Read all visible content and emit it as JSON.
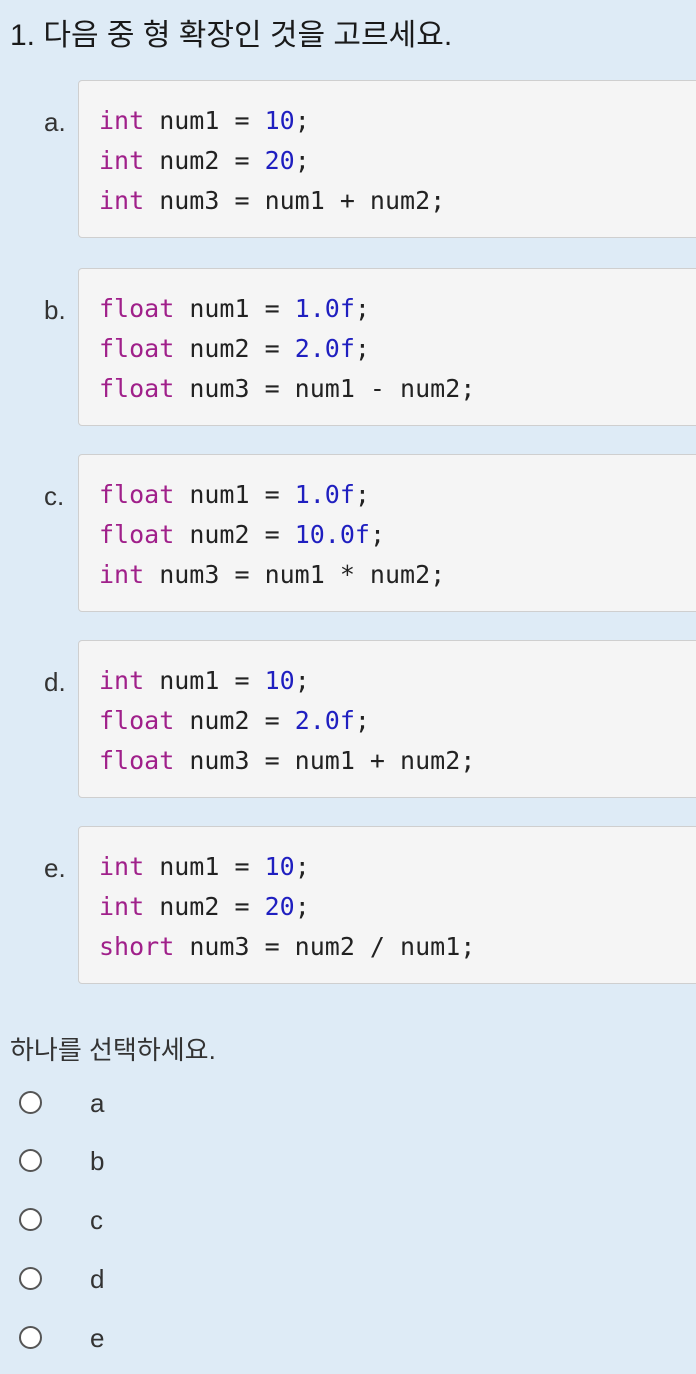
{
  "question": {
    "title": "1. 다음 중 형 확장인 것을 고르세요."
  },
  "options": [
    {
      "letter": "a.",
      "lines": [
        [
          {
            "t": "int",
            "c": "kw"
          },
          {
            "t": " num1 = ",
            "c": ""
          },
          {
            "t": "10",
            "c": "num"
          },
          {
            "t": ";",
            "c": ""
          }
        ],
        [
          {
            "t": "int",
            "c": "kw"
          },
          {
            "t": " num2 = ",
            "c": ""
          },
          {
            "t": "20",
            "c": "num"
          },
          {
            "t": ";",
            "c": ""
          }
        ],
        [
          {
            "t": "int",
            "c": "kw"
          },
          {
            "t": " num3 = num1 + num2;",
            "c": ""
          }
        ]
      ]
    },
    {
      "letter": "b.",
      "lines": [
        [
          {
            "t": "float",
            "c": "kw"
          },
          {
            "t": " num1 = ",
            "c": ""
          },
          {
            "t": "1.0f",
            "c": "num"
          },
          {
            "t": ";",
            "c": ""
          }
        ],
        [
          {
            "t": "float",
            "c": "kw"
          },
          {
            "t": " num2 = ",
            "c": ""
          },
          {
            "t": "2.0f",
            "c": "num"
          },
          {
            "t": ";",
            "c": ""
          }
        ],
        [
          {
            "t": "float",
            "c": "kw"
          },
          {
            "t": " num3 = num1 - num2;",
            "c": ""
          }
        ]
      ]
    },
    {
      "letter": "c.",
      "lines": [
        [
          {
            "t": "float",
            "c": "kw"
          },
          {
            "t": " num1 = ",
            "c": ""
          },
          {
            "t": "1.0f",
            "c": "num"
          },
          {
            "t": ";",
            "c": ""
          }
        ],
        [
          {
            "t": "float",
            "c": "kw"
          },
          {
            "t": " num2 = ",
            "c": ""
          },
          {
            "t": "10.0f",
            "c": "num"
          },
          {
            "t": ";",
            "c": ""
          }
        ],
        [
          {
            "t": "int",
            "c": "kw"
          },
          {
            "t": " num3 = num1 * num2;",
            "c": ""
          }
        ]
      ]
    },
    {
      "letter": "d.",
      "lines": [
        [
          {
            "t": "int",
            "c": "kw"
          },
          {
            "t": " num1 = ",
            "c": ""
          },
          {
            "t": "10",
            "c": "num"
          },
          {
            "t": ";",
            "c": ""
          }
        ],
        [
          {
            "t": "float",
            "c": "kw"
          },
          {
            "t": " num2 = ",
            "c": ""
          },
          {
            "t": "2.0f",
            "c": "num"
          },
          {
            "t": ";",
            "c": ""
          }
        ],
        [
          {
            "t": "float",
            "c": "kw"
          },
          {
            "t": " num3 = num1 + num2;",
            "c": ""
          }
        ]
      ]
    },
    {
      "letter": "e.",
      "lines": [
        [
          {
            "t": "int",
            "c": "kw"
          },
          {
            "t": " num1 = ",
            "c": ""
          },
          {
            "t": "10",
            "c": "num"
          },
          {
            "t": ";",
            "c": ""
          }
        ],
        [
          {
            "t": "int",
            "c": "kw"
          },
          {
            "t": " num2 = ",
            "c": ""
          },
          {
            "t": "20",
            "c": "num"
          },
          {
            "t": ";",
            "c": ""
          }
        ],
        [
          {
            "t": "short",
            "c": "kw"
          },
          {
            "t": " num3 = num2 / num1;",
            "c": ""
          }
        ]
      ]
    }
  ],
  "prompt": "하나를 선택하세요.",
  "choices": [
    {
      "label": "a",
      "selected": false
    },
    {
      "label": "b",
      "selected": false
    },
    {
      "label": "c",
      "selected": false
    },
    {
      "label": "d",
      "selected": false
    },
    {
      "label": "e",
      "selected": false
    }
  ],
  "colors": {
    "page_background": "#deebf6",
    "code_background": "#f5f5f5",
    "keyword": "#a0208a",
    "number_literal": "#1f1fc0"
  }
}
